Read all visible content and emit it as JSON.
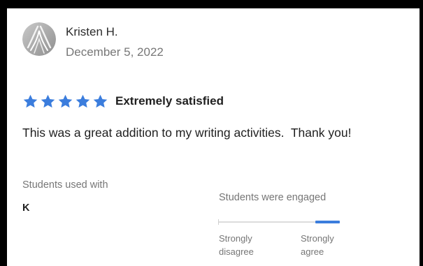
{
  "review": {
    "reviewer_name": "Kristen H.",
    "date": "December 5, 2022",
    "avatar_icon": "reviewer-avatar-icon",
    "rating": {
      "stars": 5,
      "max_stars": 5,
      "label": "Extremely satisfied",
      "star_color": "#3b7ddd",
      "star_icon": "star-icon"
    },
    "body": "This was a great addition to my writing activities.  Thank you!"
  },
  "details": {
    "students_used_with": {
      "label": "Students used with",
      "value": "K"
    },
    "engagement": {
      "label": "Students were engaged",
      "low_label_line1": "Strongly",
      "low_label_line2": "disagree",
      "high_label_line1": "Strongly",
      "high_label_line2": "agree",
      "level": 5,
      "max_level": 5,
      "fill_color": "#3b7ddd"
    }
  }
}
